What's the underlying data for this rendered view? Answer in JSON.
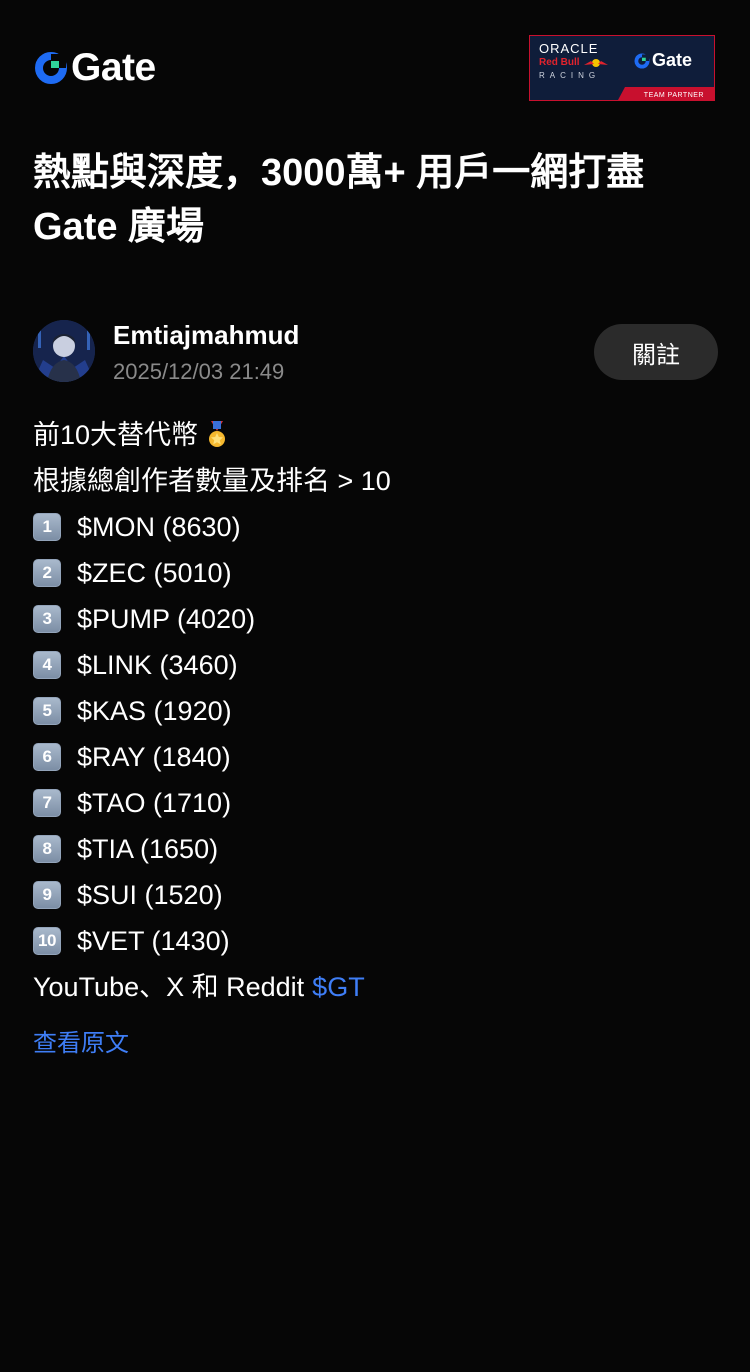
{
  "header": {
    "brand_name": "Gate",
    "brand_color": "#1e6bf3",
    "partner": {
      "oracle": "ORACLE",
      "red_bull": "Red Bull",
      "racing": "RACING",
      "gate": "Gate",
      "tagline": "TEAM PARTNER"
    }
  },
  "headline": "熱點與深度，3000萬+ 用戶一網打盡 Gate 廣場",
  "post": {
    "author": "Emtiajmahmud",
    "timestamp": "2025/12/03 21:49",
    "follow_label": "關註",
    "title_line": "前10大替代幣",
    "subtitle_line": "根據總創作者數量及排名 > 10",
    "ranking": [
      {
        "rank": "1",
        "text": "$MON (8630)"
      },
      {
        "rank": "2",
        "text": "$ZEC (5010)"
      },
      {
        "rank": "3",
        "text": "$PUMP (4020)"
      },
      {
        "rank": "4",
        "text": "$LINK (3460)"
      },
      {
        "rank": "5",
        "text": "$KAS (1920)"
      },
      {
        "rank": "6",
        "text": "$RAY (1840)"
      },
      {
        "rank": "7",
        "text": "$TAO (1710)"
      },
      {
        "rank": "8",
        "text": "$TIA (1650)"
      },
      {
        "rank": "9",
        "text": "$SUI (1520)"
      },
      {
        "rank": "10",
        "text": "$VET (1430)"
      }
    ],
    "sources_line": "YouTube、X 和 Reddit",
    "hashtag": "$GT",
    "view_original": "查看原文"
  },
  "colors": {
    "background": "#060606",
    "link": "#3f7ef6",
    "muted": "#8a8a8a",
    "follow_bg": "#2b2b2b"
  }
}
